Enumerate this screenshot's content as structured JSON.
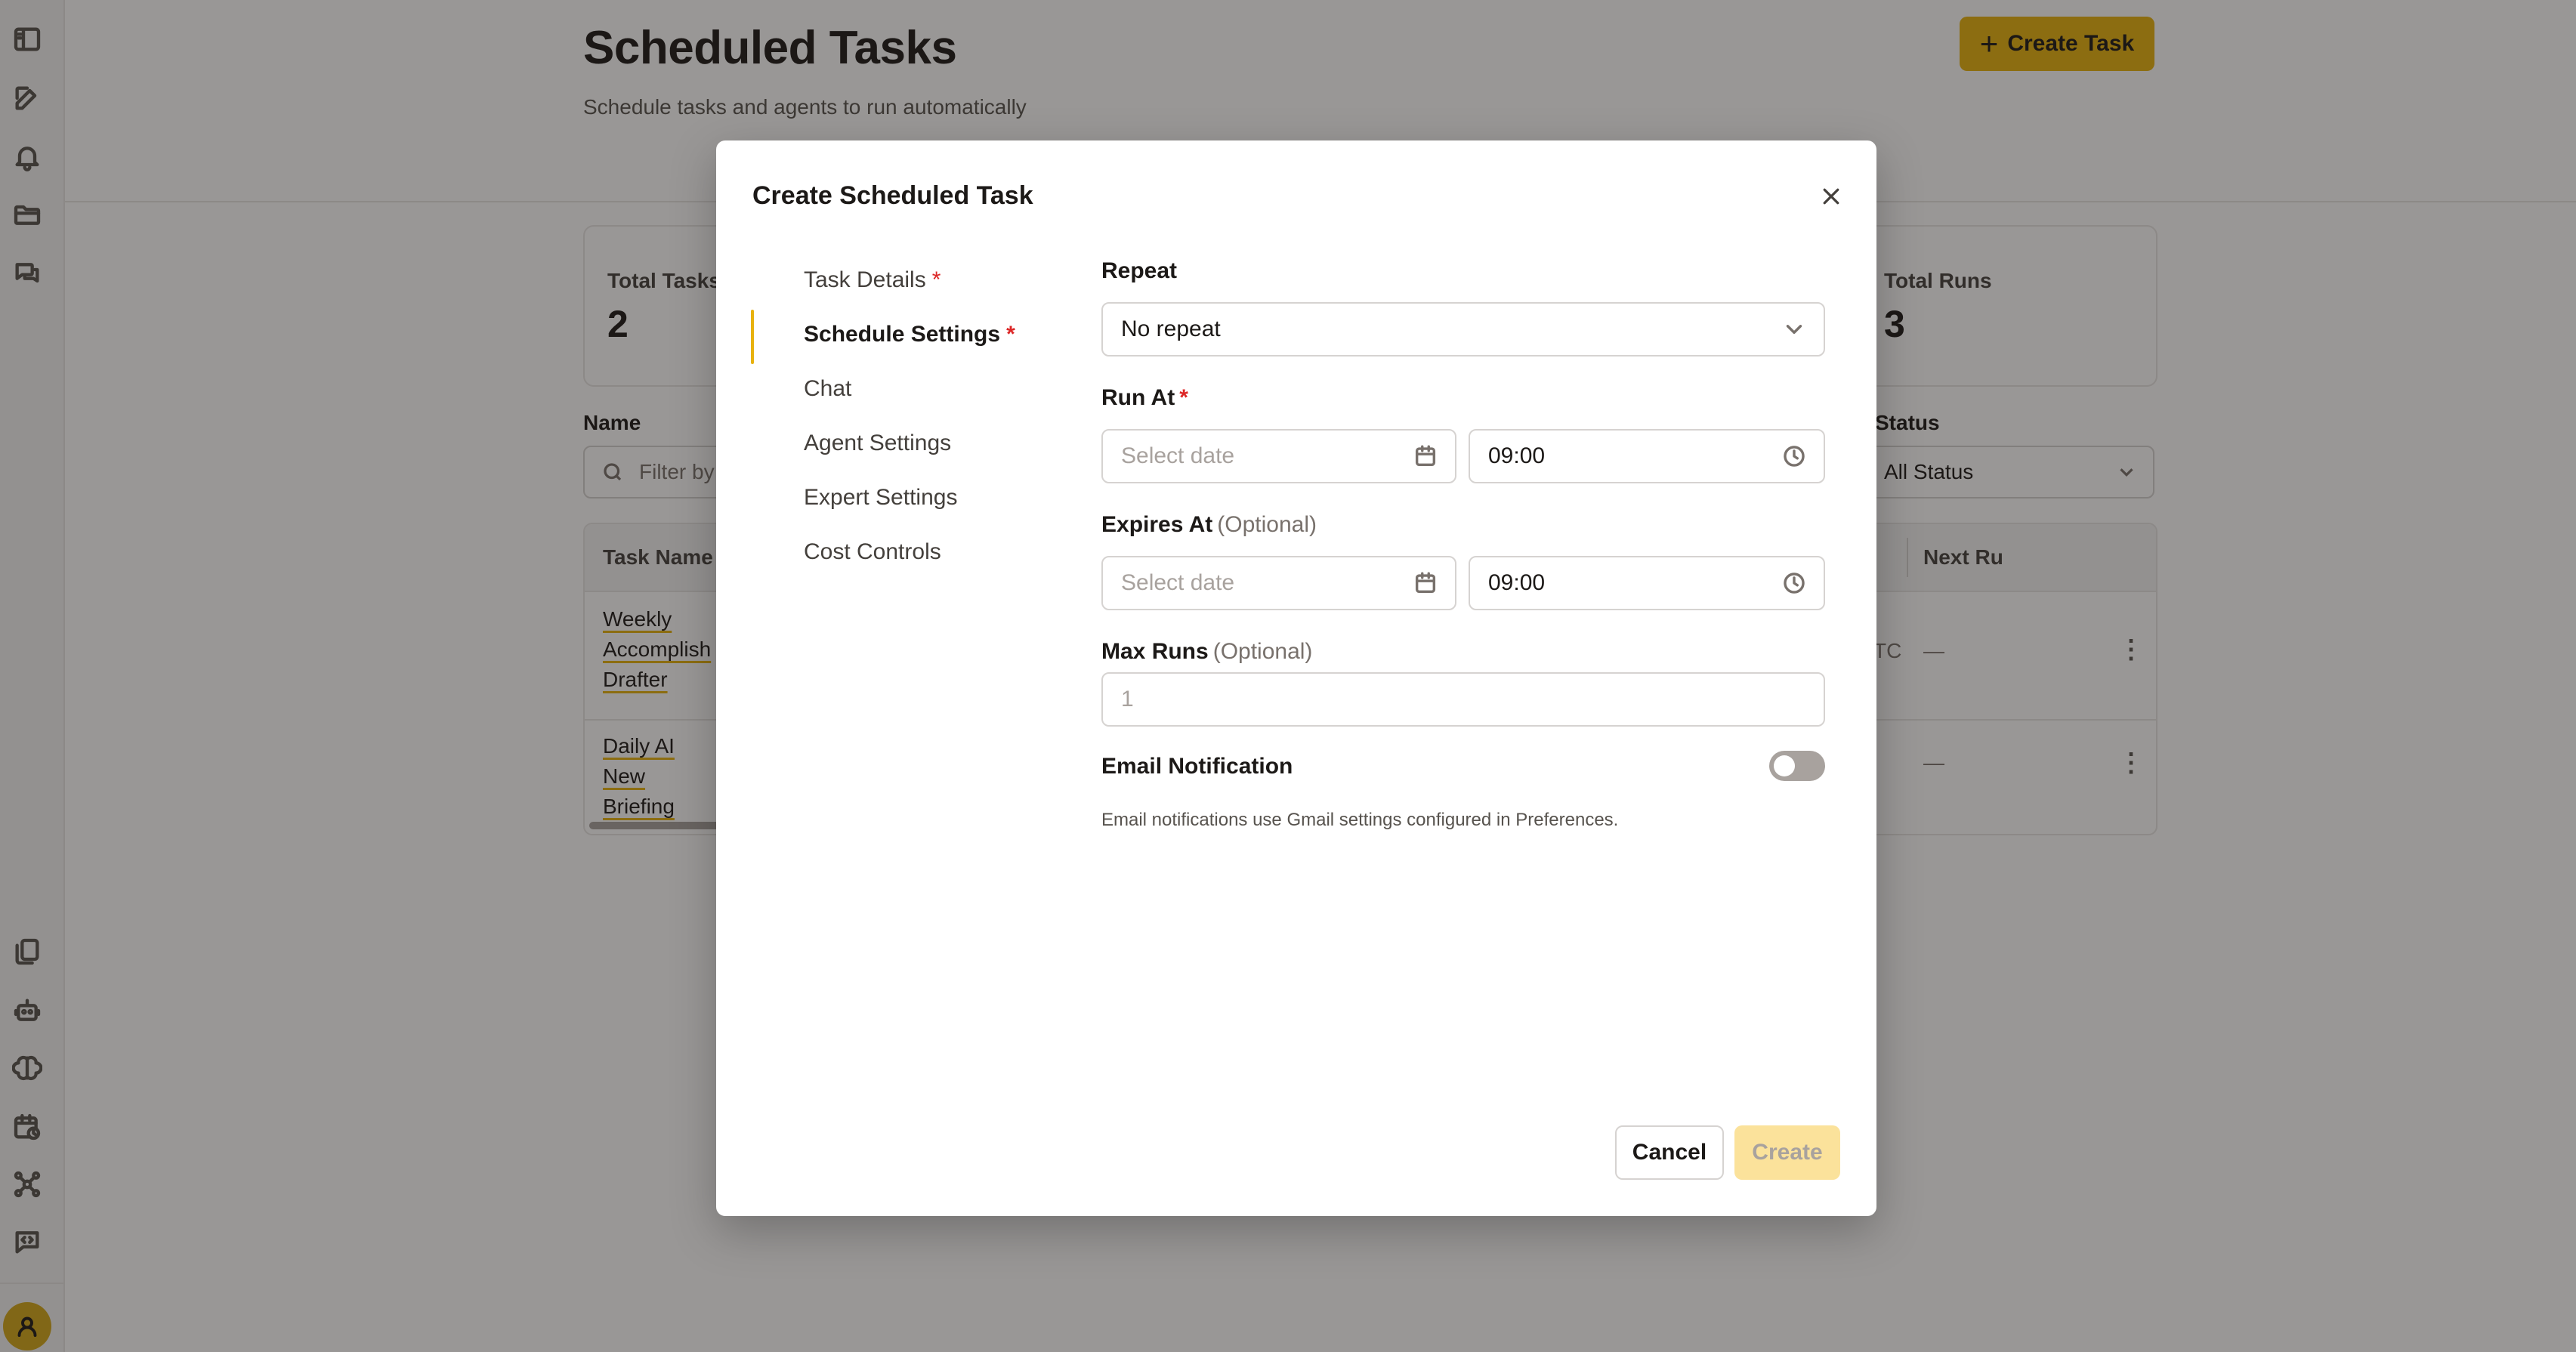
{
  "header": {
    "title": "Scheduled Tasks",
    "subtitle": "Schedule tasks and agents to run automatically",
    "create_task_label": "Create Task"
  },
  "stats": [
    {
      "label": "Total Tasks",
      "value": "2"
    },
    {
      "label": "Total Runs",
      "value": "3"
    }
  ],
  "filters": {
    "name_label": "Name",
    "name_placeholder": "Filter by",
    "status_label": "Status",
    "status_value": "All Status"
  },
  "table": {
    "columns": [
      "Task Name",
      "Next Ru"
    ],
    "rows": [
      {
        "name": "Weekly Accomplish Drafter",
        "timezone_fragment": "TC",
        "next_run": "—"
      },
      {
        "name": "Daily AI New Briefing",
        "next_run": "—"
      }
    ]
  },
  "modal": {
    "title": "Create Scheduled Task",
    "nav": [
      {
        "label": "Task Details",
        "required": "*"
      },
      {
        "label": "Schedule Settings",
        "required": "*"
      },
      {
        "label": "Chat"
      },
      {
        "label": "Agent Settings"
      },
      {
        "label": "Expert Settings"
      },
      {
        "label": "Cost Controls"
      }
    ],
    "active_nav": "Schedule Settings",
    "repeat": {
      "label": "Repeat",
      "value": "No repeat"
    },
    "run_at": {
      "label": "Run At",
      "required": "*",
      "date_placeholder": "Select date",
      "time": "09:00"
    },
    "expires_at": {
      "label": "Expires At",
      "optional": "(Optional)",
      "date_placeholder": "Select date",
      "time": "09:00"
    },
    "max_runs": {
      "label": "Max Runs",
      "optional": "(Optional)",
      "placeholder": "1"
    },
    "email": {
      "label": "Email Notification",
      "enabled": false,
      "hint": "Email notifications use Gmail settings configured in Preferences."
    },
    "cancel_label": "Cancel",
    "create_label": "Create"
  },
  "colors": {
    "accent": "#e8b20e",
    "required": "#dc2626"
  }
}
